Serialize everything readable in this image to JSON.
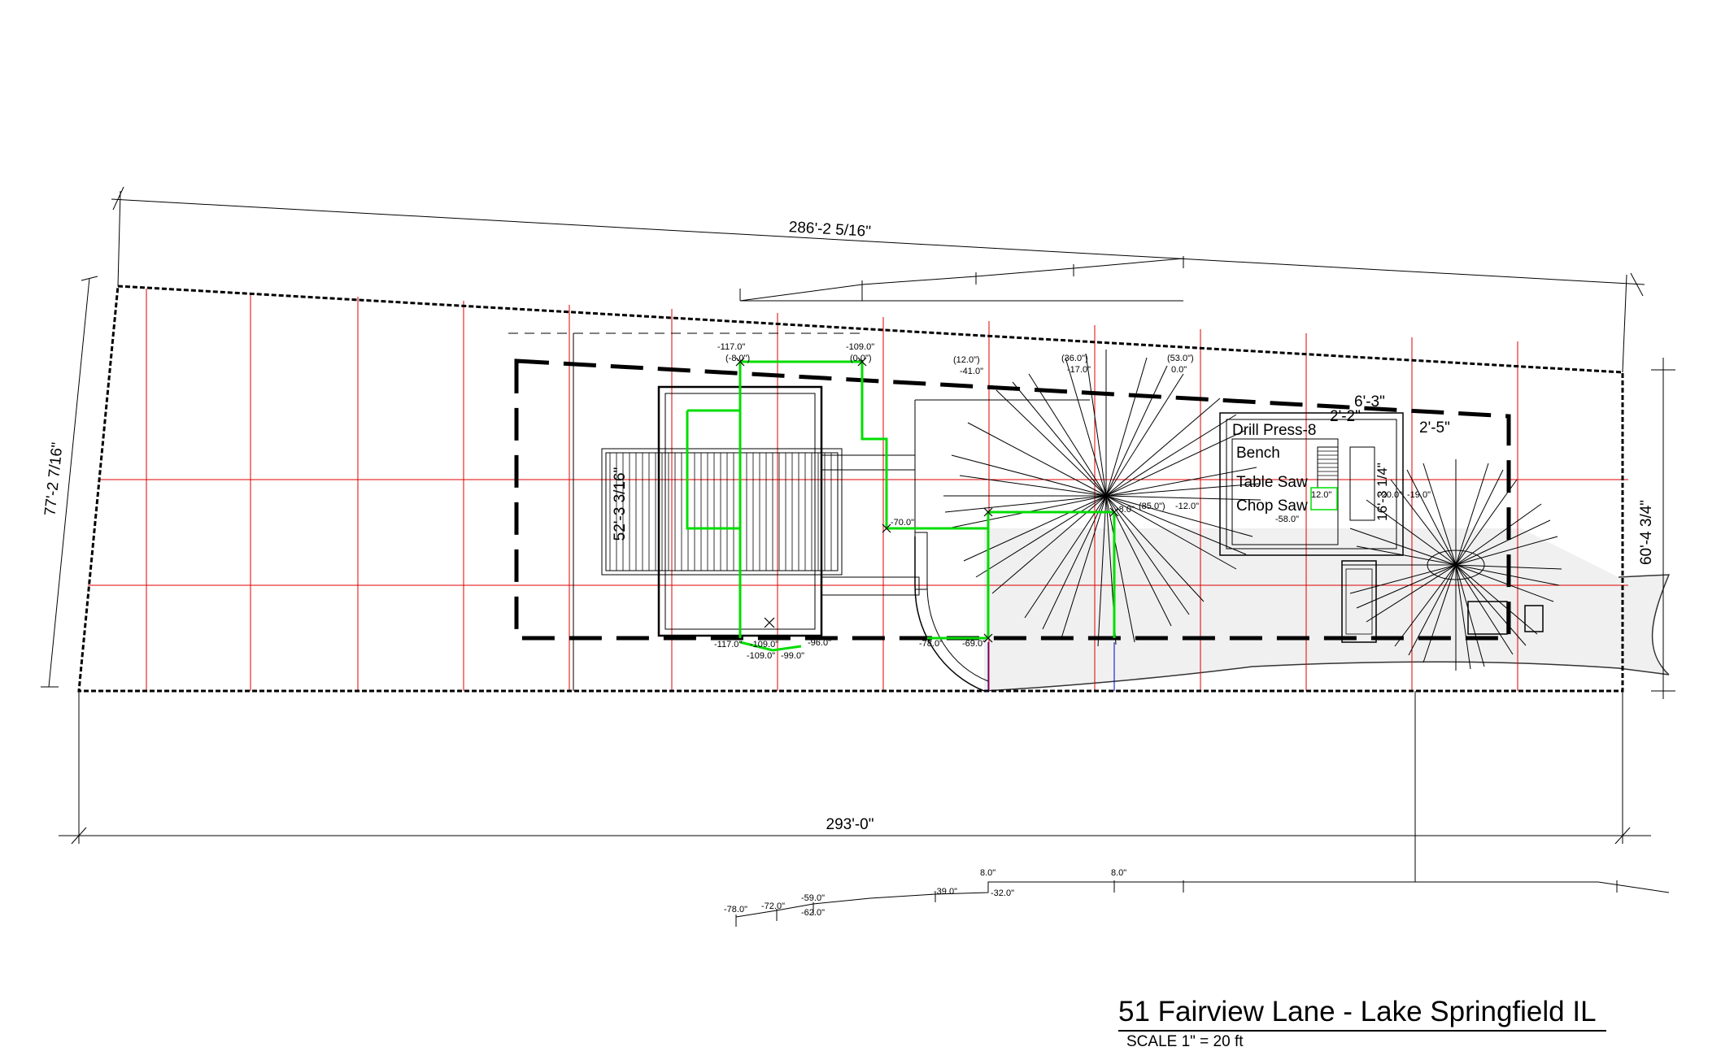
{
  "title": "51 Fairview Lane - Lake Springfield IL",
  "scale": "SCALE 1\" = 20 ft",
  "dimensions": {
    "top": "286'-2 5/16\"",
    "bottom": "293'-0\"",
    "left": "77'-2 7/16\"",
    "right": "60'-4 3/4\"",
    "house_depth": "52'-3 3/16\"",
    "shed_top": "6'-3\"",
    "shed_mid": "2'-2\"",
    "shed_right": "2'-5\"",
    "shed_side": "16'-3 1/4\""
  },
  "shed_labels": [
    "Drill Press-8",
    "Bench",
    "Table Saw",
    "Chop Saw"
  ],
  "grade_labels": {
    "top_1": "-117.0\"",
    "top_1b": "(-8.0\")",
    "top_2": "-109.0\"",
    "top_2b": "(0.0\")",
    "top_3": "(12.0\")",
    "top_3b": "-41.0\"",
    "top_4": "(36.0\")",
    "top_4b": "-17.0\"",
    "top_5": "(53.0\")",
    "top_5b": "0.0\"",
    "mid_1": "-70.0\"",
    "mid_2": "-8.0\"",
    "mid_3": "(85.0\")",
    "mid_4": "-12.0\"",
    "mid_5": "-58.0\"",
    "mid_6": "12.0\"",
    "mid_7": "-20.0\"",
    "mid_8": "-19.0\"",
    "bot_1": "-117.0\"",
    "bot_2": "-109.0\"",
    "bot_3": "-96.0\"",
    "bot_4": "-109.0\"",
    "bot_5": "-99.0\"",
    "bot_6": "-78.0\"",
    "bot_7": "-69.0\"",
    "prof_1": "8.0\"",
    "prof_2": "8.0\"",
    "prof_3": "-39.0\"",
    "prof_4": "-32.0\"",
    "prof_5": "-59.0\"",
    "prof_6": "-62.0\"",
    "prof_7": "-72.0\"",
    "prof_8": "-78.0\""
  },
  "colors": {
    "grid": "#e00000",
    "path": "#00dd00",
    "line": "#000000",
    "driveway": "#f0f0f0"
  }
}
